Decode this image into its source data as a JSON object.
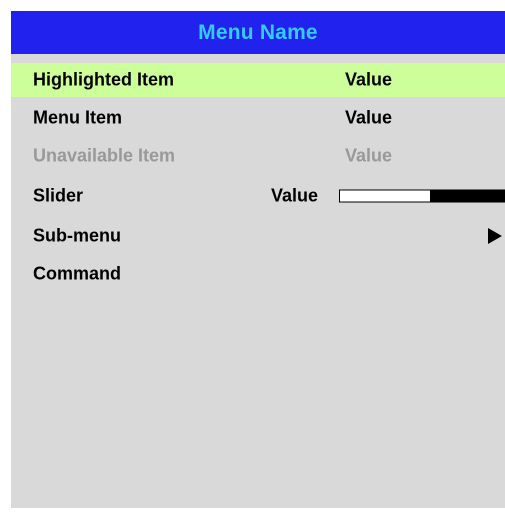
{
  "menu": {
    "title": "Menu Name",
    "items": [
      {
        "label": "Highlighted Item",
        "value": "Value",
        "state": "highlighted"
      },
      {
        "label": "Menu Item",
        "value": "Value",
        "state": "normal"
      },
      {
        "label": "Unavailable Item",
        "value": "Value",
        "state": "unavailable"
      },
      {
        "label": "Slider",
        "value": "Value",
        "state": "normal",
        "type": "slider",
        "slider_level": 0.45
      },
      {
        "label": "Sub-menu",
        "state": "normal",
        "type": "submenu",
        "icon": "triangle-right-icon"
      },
      {
        "label": "Command",
        "state": "normal",
        "type": "command"
      }
    ]
  },
  "colors": {
    "background": "#d9d9d9",
    "header_background": "#2222ee",
    "title_color": "#33ccff",
    "highlight": "#ccff99",
    "text": "#000000",
    "disabled_text": "#999999"
  }
}
